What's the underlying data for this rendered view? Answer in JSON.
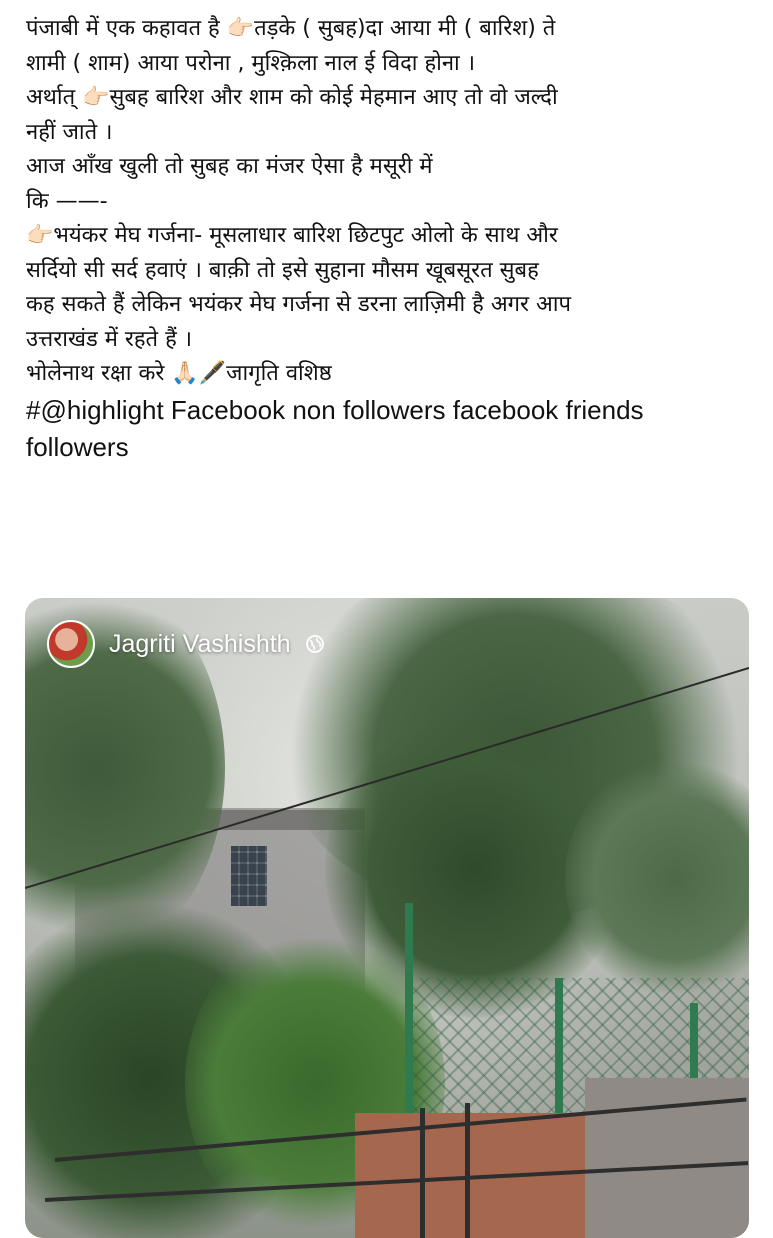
{
  "post": {
    "lines": [
      "पंजाबी में एक कहावत है 👉🏻तड़के ( सुबह)दा आया मी ( बारिश) ते",
      "शामी ( शाम) आया परोना , मुश्क़िला नाल ई विदा होना ।",
      "अर्थात् 👉🏻सुबह बारिश और शाम को कोई मेहमान आए तो वो जल्दी",
      "नहीं जाते ।",
      "आज आँख खुली तो सुबह का मंजर ऐसा है मसूरी में",
      "कि ——-",
      "👉🏻भयंकर मेघ गर्जना- मूसलाधार बारिश छिटपुट ओलो के साथ और",
      "सर्दियो सी सर्द हवाएं । बाक़ी तो इसे सुहाना मौसम खूबसूरत सुबह",
      "कह सकते हैं लेकिन भयंकर मेघ गर्जना से डरना लाज़िमी है अगर आप",
      "उत्तराखंड में रहते हैं ।",
      "भोलेनाथ रक्षा करे 🙏🏻🖋️जागृति वशिष्ठ"
    ],
    "hashtag_lines": [
      "#@highlight Facebook non followers facebook friends",
      "followers"
    ]
  },
  "media": {
    "author_name": "Jagriti Vashishth",
    "privacy_icon": "globe-icon"
  }
}
